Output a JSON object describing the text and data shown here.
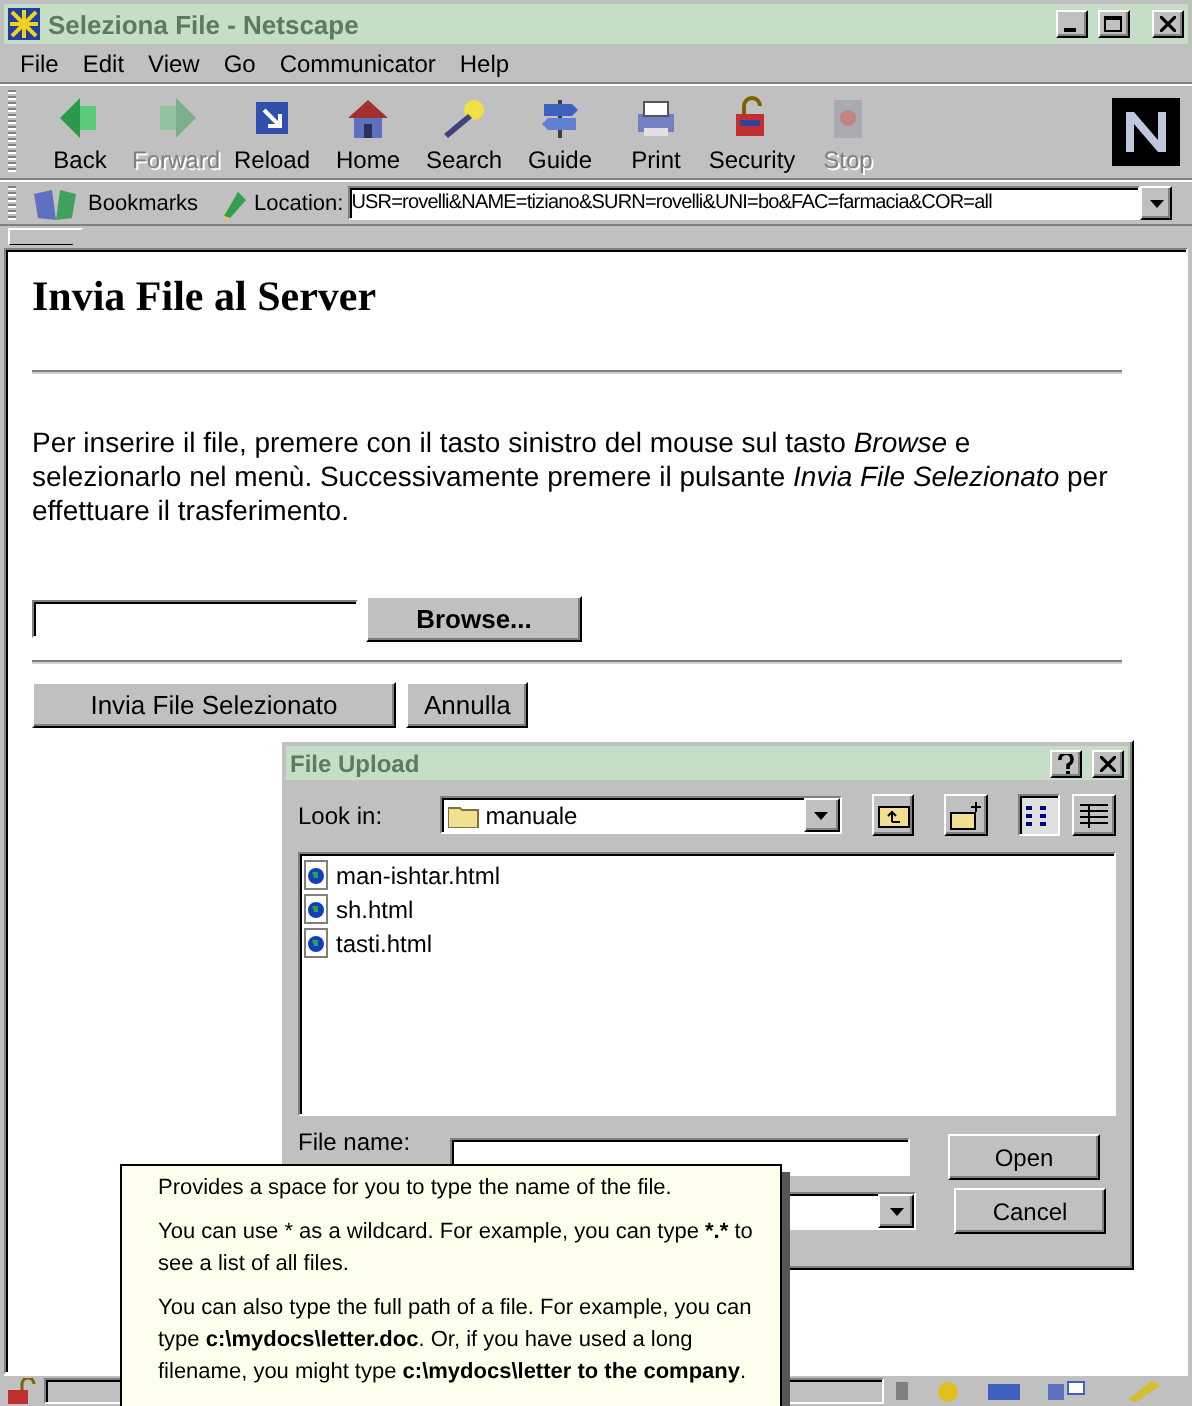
{
  "window": {
    "title": "Seleziona File - Netscape",
    "active": false
  },
  "menu": [
    "File",
    "Edit",
    "View",
    "Go",
    "Communicator",
    "Help"
  ],
  "toolbar": [
    {
      "label": "Back",
      "kind": "back",
      "disabled": false
    },
    {
      "label": "Forward",
      "kind": "forward",
      "disabled": true
    },
    {
      "label": "Reload",
      "kind": "reload",
      "disabled": false
    },
    {
      "label": "Home",
      "kind": "home",
      "disabled": false
    },
    {
      "label": "Search",
      "kind": "search",
      "disabled": false
    },
    {
      "label": "Guide",
      "kind": "guide",
      "disabled": false
    },
    {
      "label": "Print",
      "kind": "print",
      "disabled": false
    },
    {
      "label": "Security",
      "kind": "security",
      "disabled": false
    },
    {
      "label": "Stop",
      "kind": "stop",
      "disabled": true
    }
  ],
  "location_bar": {
    "bookmarks": "Bookmarks",
    "label": "Location:",
    "url": "USR=rovelli&NAME=tiziano&SURN=rovelli&UNI=bo&FAC=farmacia&COR=all"
  },
  "page": {
    "heading": "Invia File al Server",
    "instructions": "Per inserire il file, premere con il tasto sinistro del mouse sul tasto *Browse* e selezionarlo nel menù. Successivamente premere il pulsante *Invia File Selezionato* per effettuare il trasferimento.",
    "browse_button": "Browse...",
    "submit_button": "Invia File Selezionato",
    "cancel_button": "Annulla"
  },
  "dialog": {
    "title": "File Upload",
    "active": false,
    "look_in_label": "Look in:",
    "folder": "manuale",
    "files": [
      {
        "name": "man-ishtar.html",
        "selected": false
      },
      {
        "name": "sh.html",
        "selected": false
      },
      {
        "name": "tasti.html",
        "selected": false
      }
    ],
    "file_name_label": "File name:",
    "buttons": [
      "Open",
      "Cancel"
    ]
  },
  "tooltip": {
    "paragraphs": [
      [
        {
          "text": "Provides a space for you to type the name of the file.",
          "bold": false
        }
      ],
      [
        {
          "text": "You can use * as a wildcard. For example, you can type ",
          "bold": false
        },
        {
          "text": "*.*",
          "bold": true
        },
        {
          "text": " to see a list of all files.",
          "bold": false
        }
      ],
      [
        {
          "text": "You can also type the full path of a file. For example, you can type ",
          "bold": false
        },
        {
          "text": "c:\\mydocs\\letter.doc",
          "bold": true
        },
        {
          "text": ". Or, if you have used a long filename, you might type ",
          "bold": false
        },
        {
          "text": "c:\\mydocs\\letter to the company",
          "bold": true
        },
        {
          "text": ".",
          "bold": false
        }
      ]
    ]
  }
}
